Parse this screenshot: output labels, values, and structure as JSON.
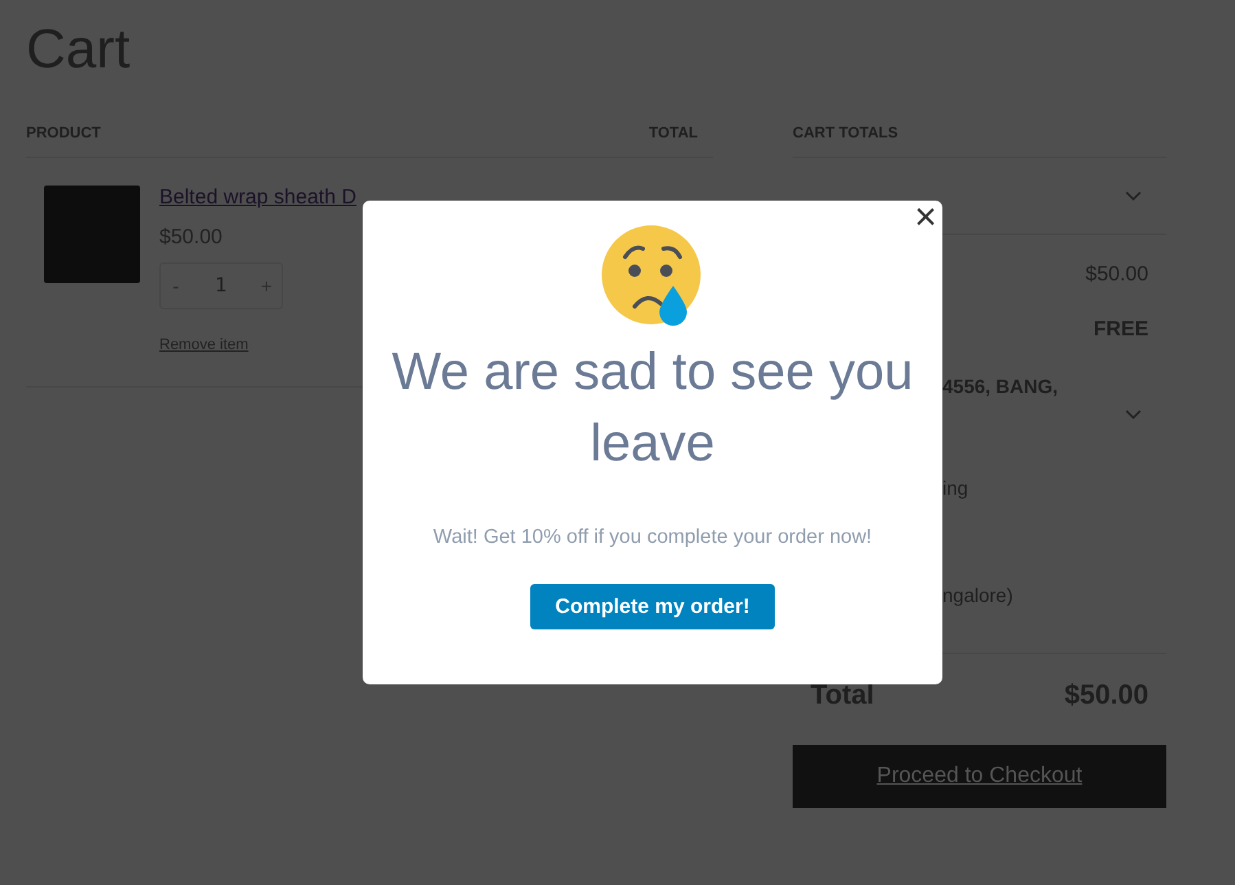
{
  "page": {
    "title": "Cart"
  },
  "cart_table": {
    "columns": [
      "PRODUCT",
      "TOTAL"
    ],
    "items": [
      {
        "name": "Belted wrap sheath D",
        "price": "$50.00",
        "quantity": "1",
        "decrease": "-",
        "increase": "+",
        "remove": "Remove item"
      }
    ]
  },
  "cart_totals": {
    "heading": "CART TOTALS",
    "subtotal": "$50.00",
    "shipping": "FREE",
    "address": "4556, BANG,",
    "shipping_method": "ing",
    "store": "ngalore)",
    "total_label": "Total",
    "total": "$50.00",
    "checkout": "Proceed to Checkout"
  },
  "modal": {
    "close": "×",
    "heading": "We are sad to see you leave",
    "message": "Wait! Get 10% off if you complete your order now!",
    "button": "Complete my order!"
  }
}
